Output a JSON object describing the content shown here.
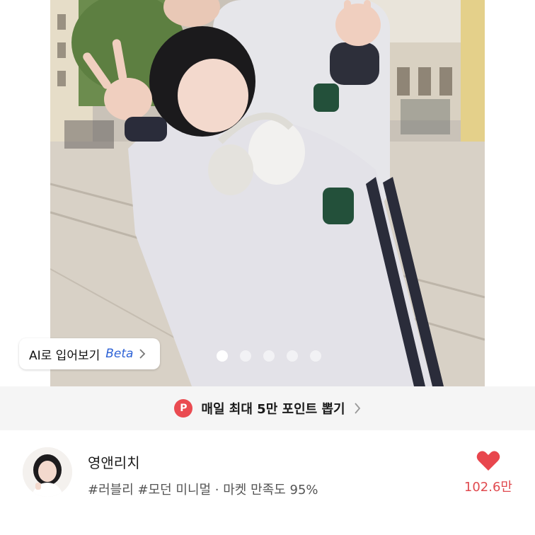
{
  "ai_tryon": {
    "label": "AI로 입어보기",
    "beta": "Beta"
  },
  "carousel": {
    "total": 5,
    "active_index": 0
  },
  "promo": {
    "badge": "P",
    "text": "매일 최대 5만 포인트 뽑기"
  },
  "shop": {
    "name": "영앤리치",
    "tags": "#러블리 #모던 미니멀 · 마켓 만족도 95%",
    "like_count": "102.6만"
  },
  "colors": {
    "accent_red": "#ea4b51",
    "beta_blue": "#2d62d6"
  }
}
